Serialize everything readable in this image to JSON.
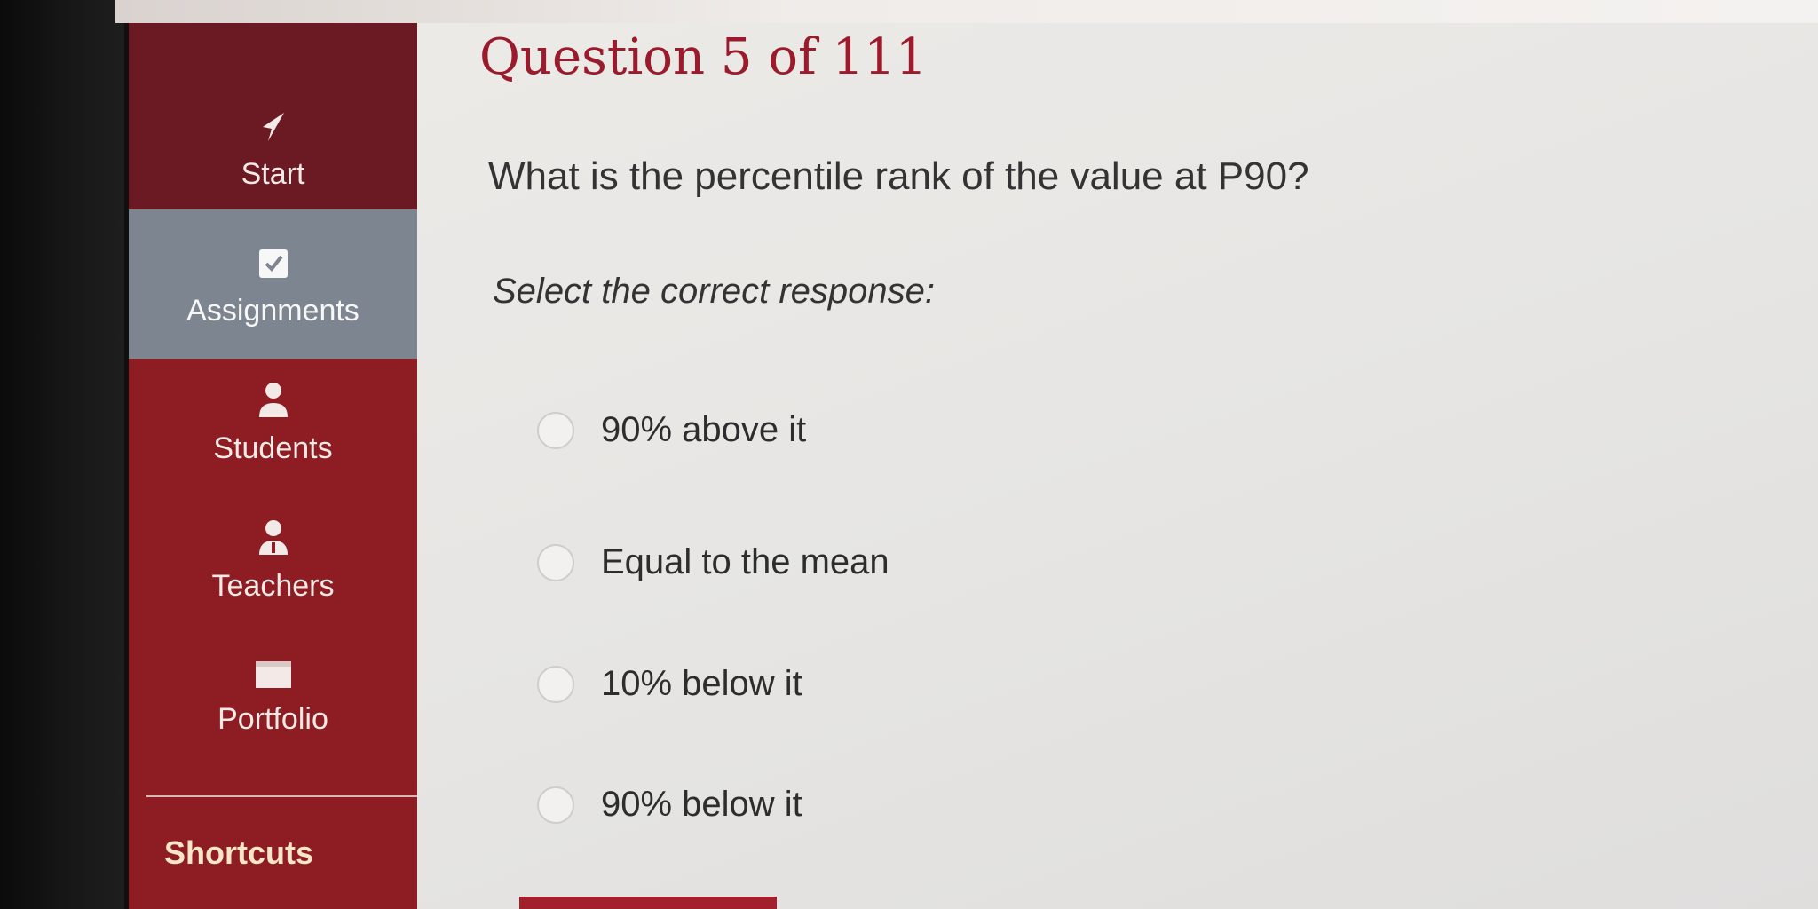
{
  "sidebar": {
    "items": [
      {
        "label": "Start",
        "icon": "arrow-cursor-icon"
      },
      {
        "label": "Assignments",
        "icon": "checkbox-icon"
      },
      {
        "label": "Students",
        "icon": "person-icon"
      },
      {
        "label": "Teachers",
        "icon": "teacher-icon"
      },
      {
        "label": "Portfolio",
        "icon": "folder-icon"
      }
    ],
    "shortcuts_label": "Shortcuts"
  },
  "question": {
    "title": "Question 5 of 111",
    "text": "What is the percentile rank of the value at P90?",
    "instruction": "Select the correct response:",
    "options": [
      {
        "label": "90% above it"
      },
      {
        "label": "Equal to the mean"
      },
      {
        "label": "10% below it"
      },
      {
        "label": "90% below it"
      }
    ]
  },
  "colors": {
    "sidebar": "#8e1d23",
    "sidebar_active": "#7d8590",
    "title": "#9b1a2b"
  }
}
